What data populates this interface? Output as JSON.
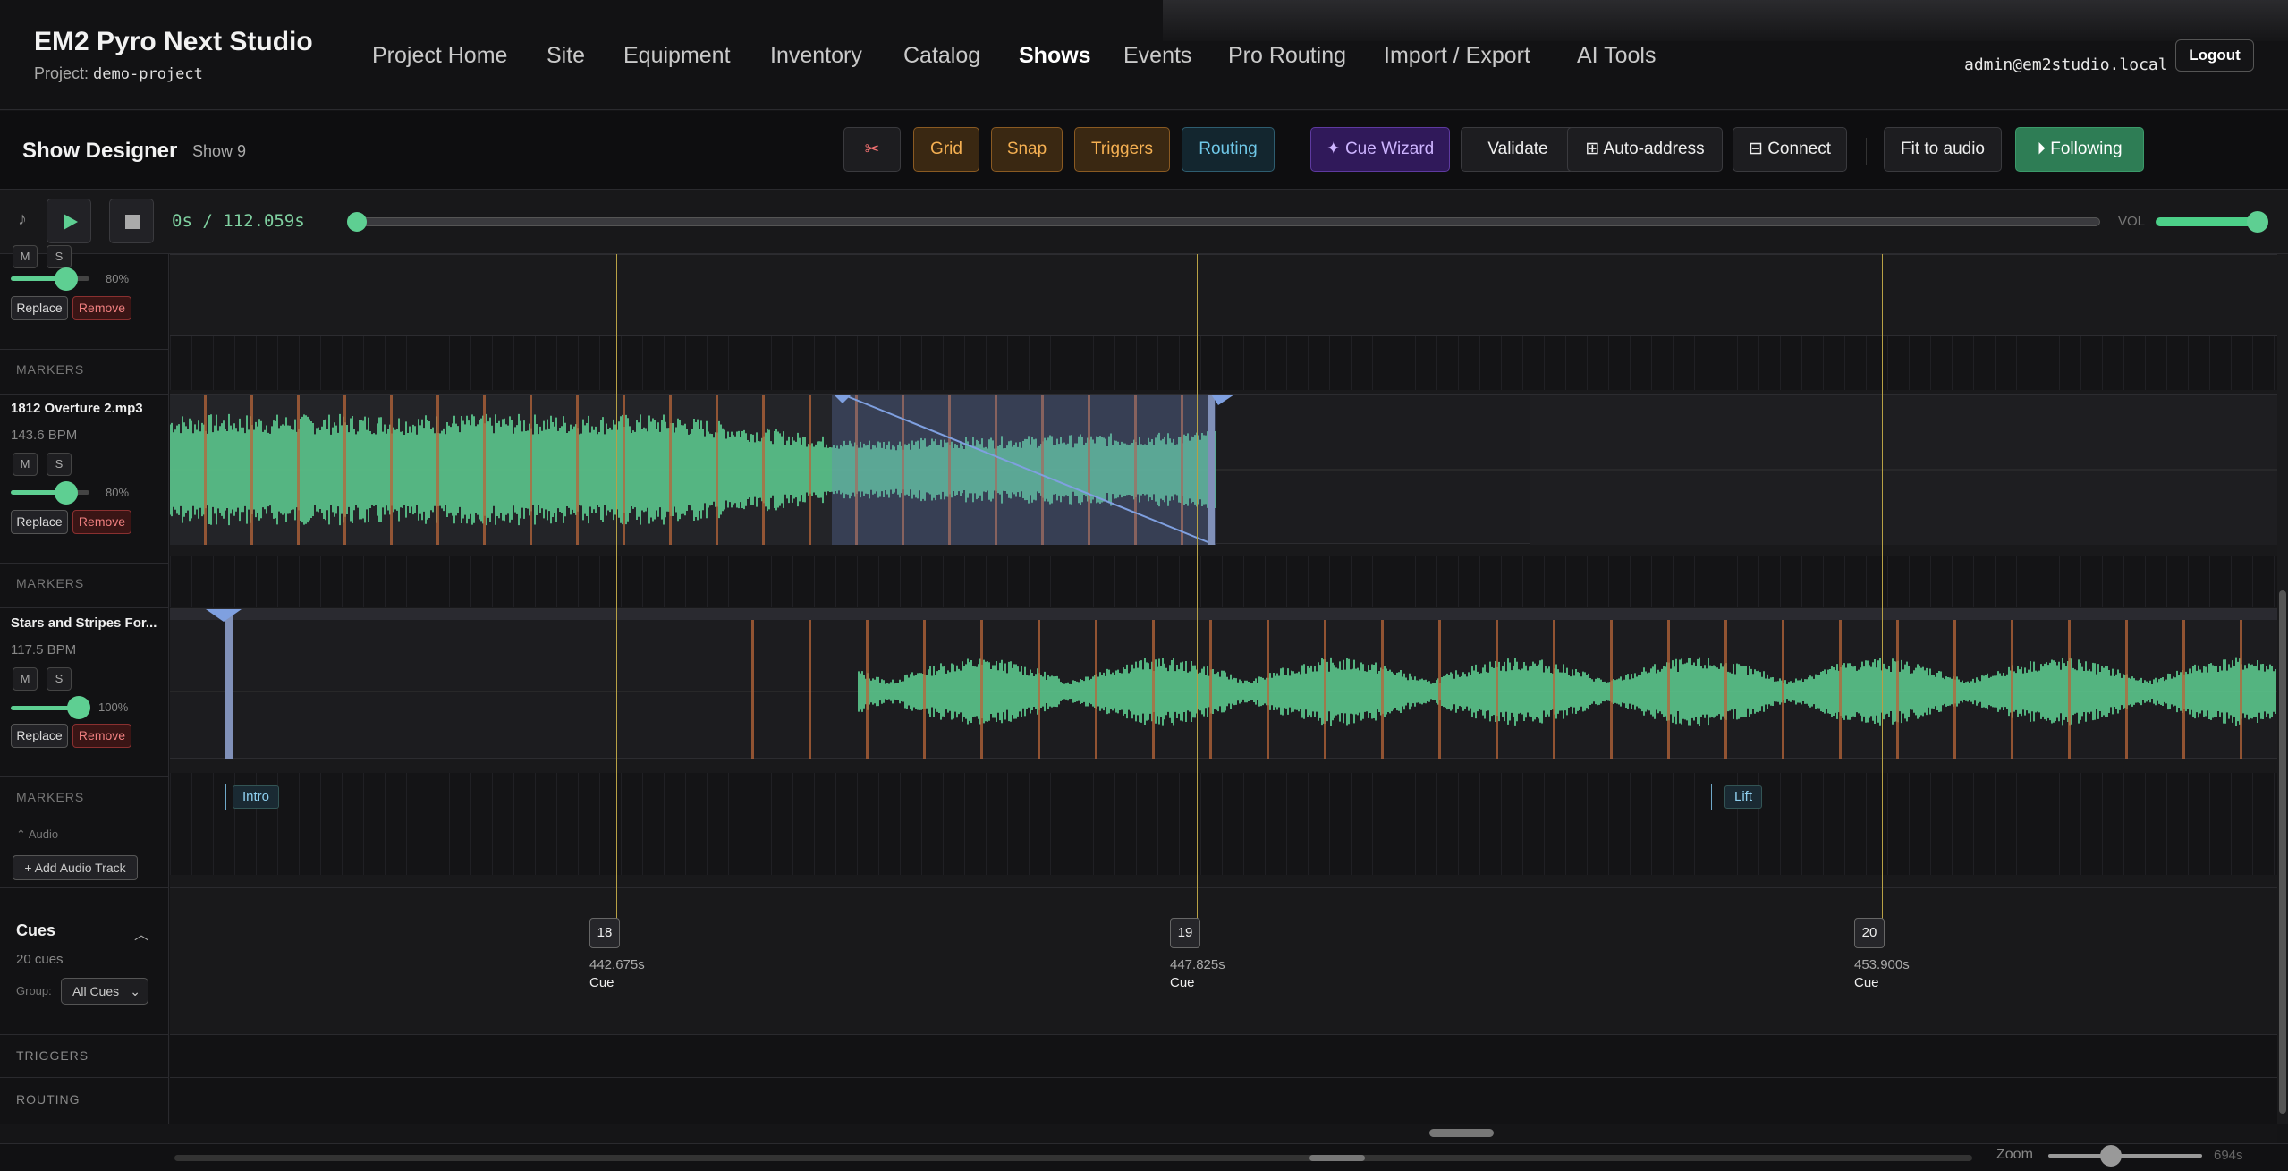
{
  "app": {
    "title": "EM2 Pyro Next Studio",
    "project_label": "Project:",
    "project_name": "demo-project"
  },
  "nav": [
    "Project Home",
    "Site",
    "Equipment",
    "Inventory",
    "Catalog",
    "Shows",
    "Events",
    "Pro Routing",
    "Import / Export",
    "AI Tools"
  ],
  "nav_active": "Shows",
  "user": {
    "email": "admin@em2studio.local",
    "logout_label": "Logout"
  },
  "toolbar": {
    "title": "Show Designer",
    "show_name": "Show 9",
    "grid": "Grid",
    "snap": "Snap",
    "triggers": "Triggers",
    "routing": "Routing",
    "cue_wizard": "✦ Cue Wizard",
    "validate": "Validate",
    "auto_address": "⊞ Auto-address",
    "connect": "⊟ Connect",
    "fit_audio": "Fit to audio",
    "following": "⏵ Following"
  },
  "transport": {
    "time": "0s / 112.059s",
    "vol_label": "VOL",
    "volume": 1.0,
    "position": 0.0
  },
  "tracks": [
    {
      "name": "",
      "bpm": "",
      "mute": "M",
      "solo": "S",
      "volume_pct": "80%",
      "volume": 0.8,
      "replace": "Replace",
      "remove": "Remove"
    },
    {
      "name": "1812 Overture 2.mp3",
      "bpm": "143.6 BPM",
      "mute": "M",
      "solo": "S",
      "volume_pct": "80%",
      "volume": 0.8,
      "replace": "Replace",
      "remove": "Remove"
    },
    {
      "name": "Stars and Stripes For...",
      "bpm": "117.5 BPM",
      "mute": "M",
      "solo": "S",
      "volume_pct": "100%",
      "volume": 1.0,
      "replace": "Replace",
      "remove": "Remove"
    }
  ],
  "markers_label": "MARKERS",
  "markers": [
    "Intro",
    "Lift"
  ],
  "audio_section": {
    "label": "Audio",
    "add_button": "+ Add Audio Track"
  },
  "cues_panel": {
    "title": "Cues",
    "count": "20 cues",
    "group_label": "Group:",
    "group_value": "All Cues"
  },
  "cues": [
    {
      "number": "18",
      "time": "442.675s",
      "type": "Cue"
    },
    {
      "number": "19",
      "time": "447.825s",
      "type": "Cue"
    },
    {
      "number": "20",
      "time": "453.900s",
      "type": "Cue"
    }
  ],
  "lanes": {
    "triggers": "TRIGGERS",
    "routing": "ROUTING"
  },
  "zoom": {
    "label": "Zoom",
    "value": "694s"
  },
  "colors": {
    "waveform": "#5ecf92",
    "beat": "#b8663a",
    "cue_line": "#b8a145",
    "accent_green": "#2e7d55"
  }
}
